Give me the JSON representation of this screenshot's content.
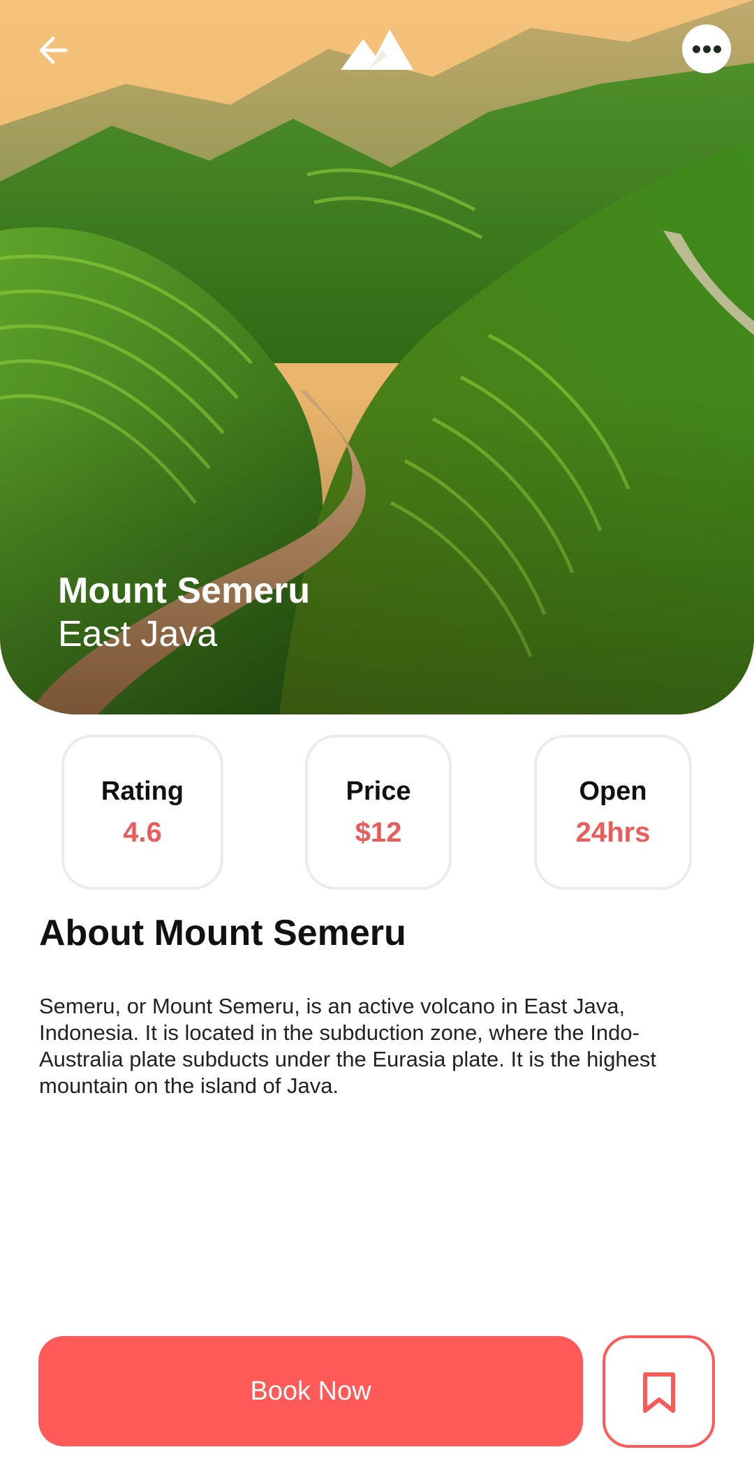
{
  "hero": {
    "title": "Mount Semeru",
    "subtitle": "East Java"
  },
  "header": {
    "back_icon": "arrow-left-icon",
    "logo_icon": "mountain-logo-icon",
    "more_icon": "more-horizontal-icon"
  },
  "stats": [
    {
      "label": "Rating",
      "value": "4.6"
    },
    {
      "label": "Price",
      "value": "$12"
    },
    {
      "label": "Open",
      "value": "24hrs"
    }
  ],
  "about": {
    "title": "About Mount Semeru",
    "body": "Semeru, or Mount Semeru, is an active volcano in East Java, Indonesia. It is located in the subduction zone, where the Indo-Australia plate subducts under the Eurasia plate. It is the highest mountain on the island of Java."
  },
  "actions": {
    "book_label": "Book Now",
    "bookmark_icon": "bookmark-icon"
  },
  "colors": {
    "accent": "#ff5a57",
    "stat_value": "#e85c5c",
    "card_border": "#ececec"
  }
}
